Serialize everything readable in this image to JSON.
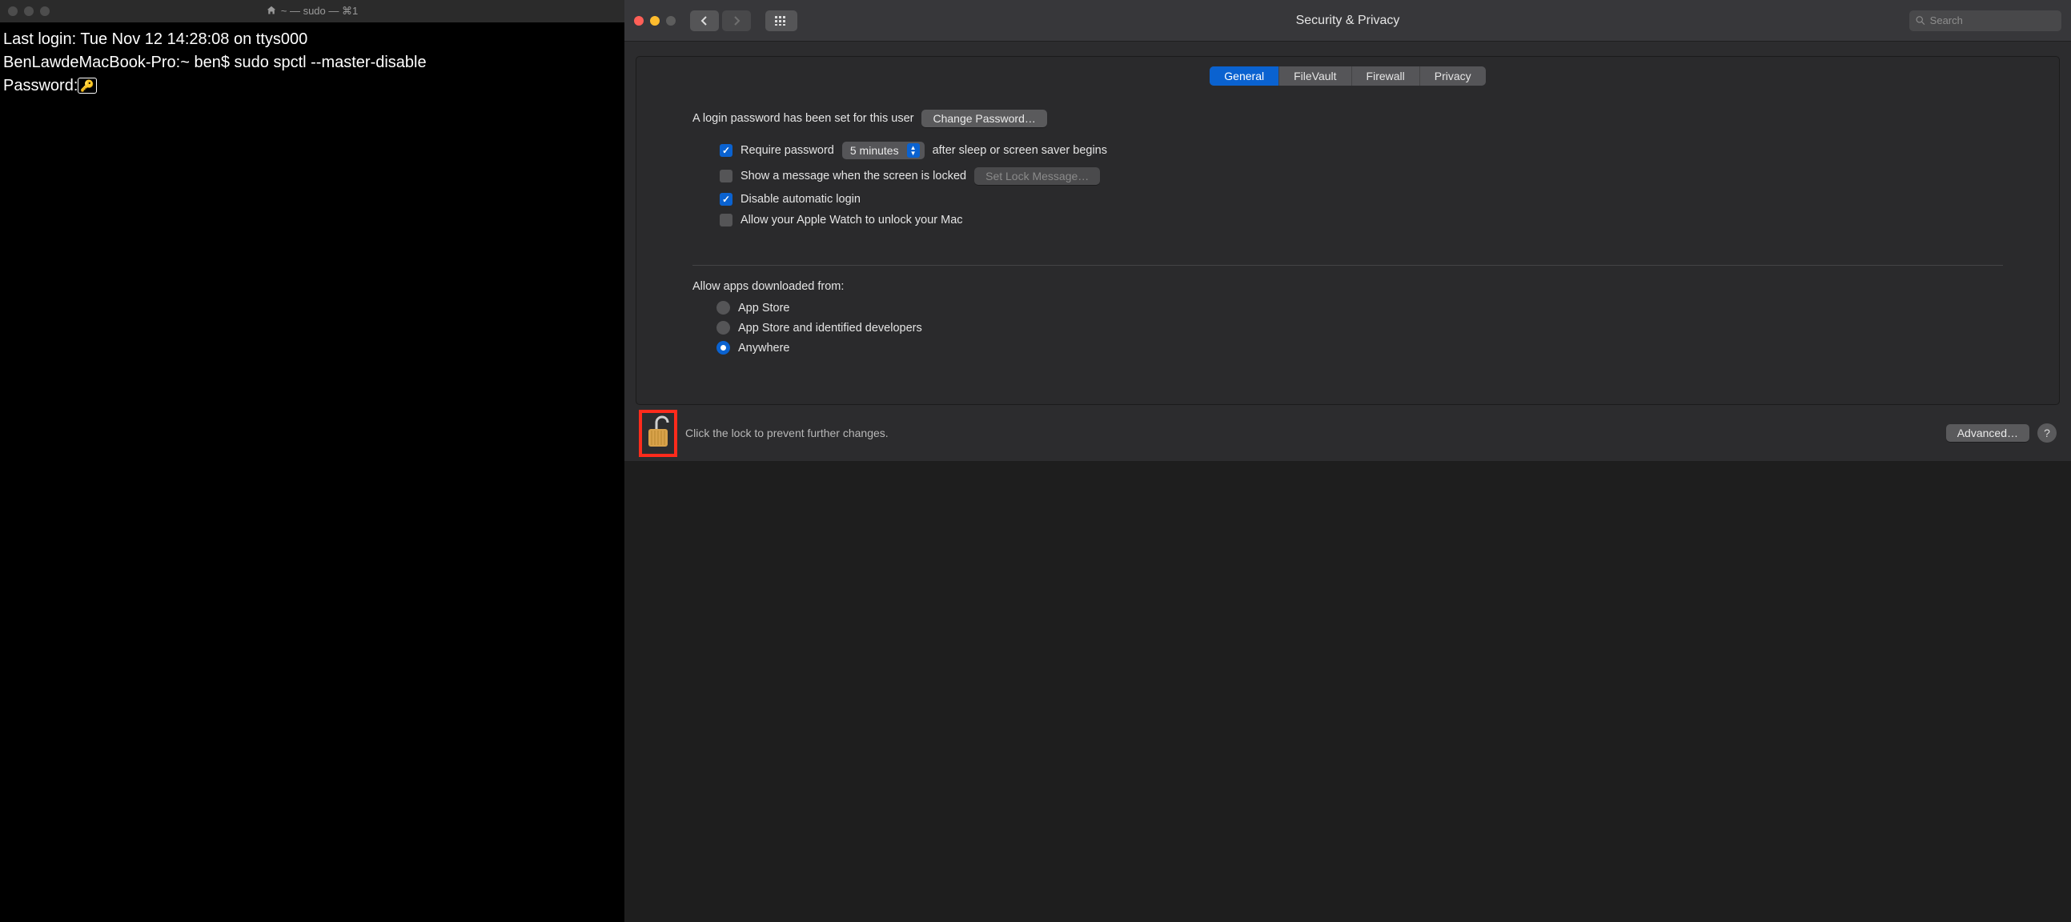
{
  "terminal": {
    "title": "~ — sudo — ⌘1",
    "line1": "Last login: Tue Nov 12 14:28:08 on ttys000",
    "line2": "BenLawdeMacBook-Pro:~ ben$ sudo spctl --master-disable",
    "password_label": "Password:"
  },
  "prefs": {
    "title": "Security & Privacy",
    "search_placeholder": "Search",
    "tabs": {
      "general": "General",
      "filevault": "FileVault",
      "firewall": "Firewall",
      "privacy": "Privacy"
    },
    "login_password_text": "A login password has been set for this user",
    "change_password_btn": "Change Password…",
    "require_password_label": "Require password",
    "require_password_delay": "5 minutes",
    "after_sleep_text": "after sleep or screen saver begins",
    "show_message_label": "Show a message when the screen is locked",
    "set_lock_message_btn": "Set Lock Message…",
    "disable_auto_login_label": "Disable automatic login",
    "allow_watch_label": "Allow your Apple Watch to unlock your Mac",
    "allow_apps_heading": "Allow apps downloaded from:",
    "radios": {
      "appstore": "App Store",
      "identified": "App Store and identified developers",
      "anywhere": "Anywhere"
    },
    "lock_text": "Click the lock to prevent further changes.",
    "advanced_btn": "Advanced…",
    "help": "?"
  },
  "checkboxes": {
    "require_password": true,
    "show_message": false,
    "disable_auto_login": true,
    "allow_watch": false
  },
  "radio_selected": "anywhere"
}
